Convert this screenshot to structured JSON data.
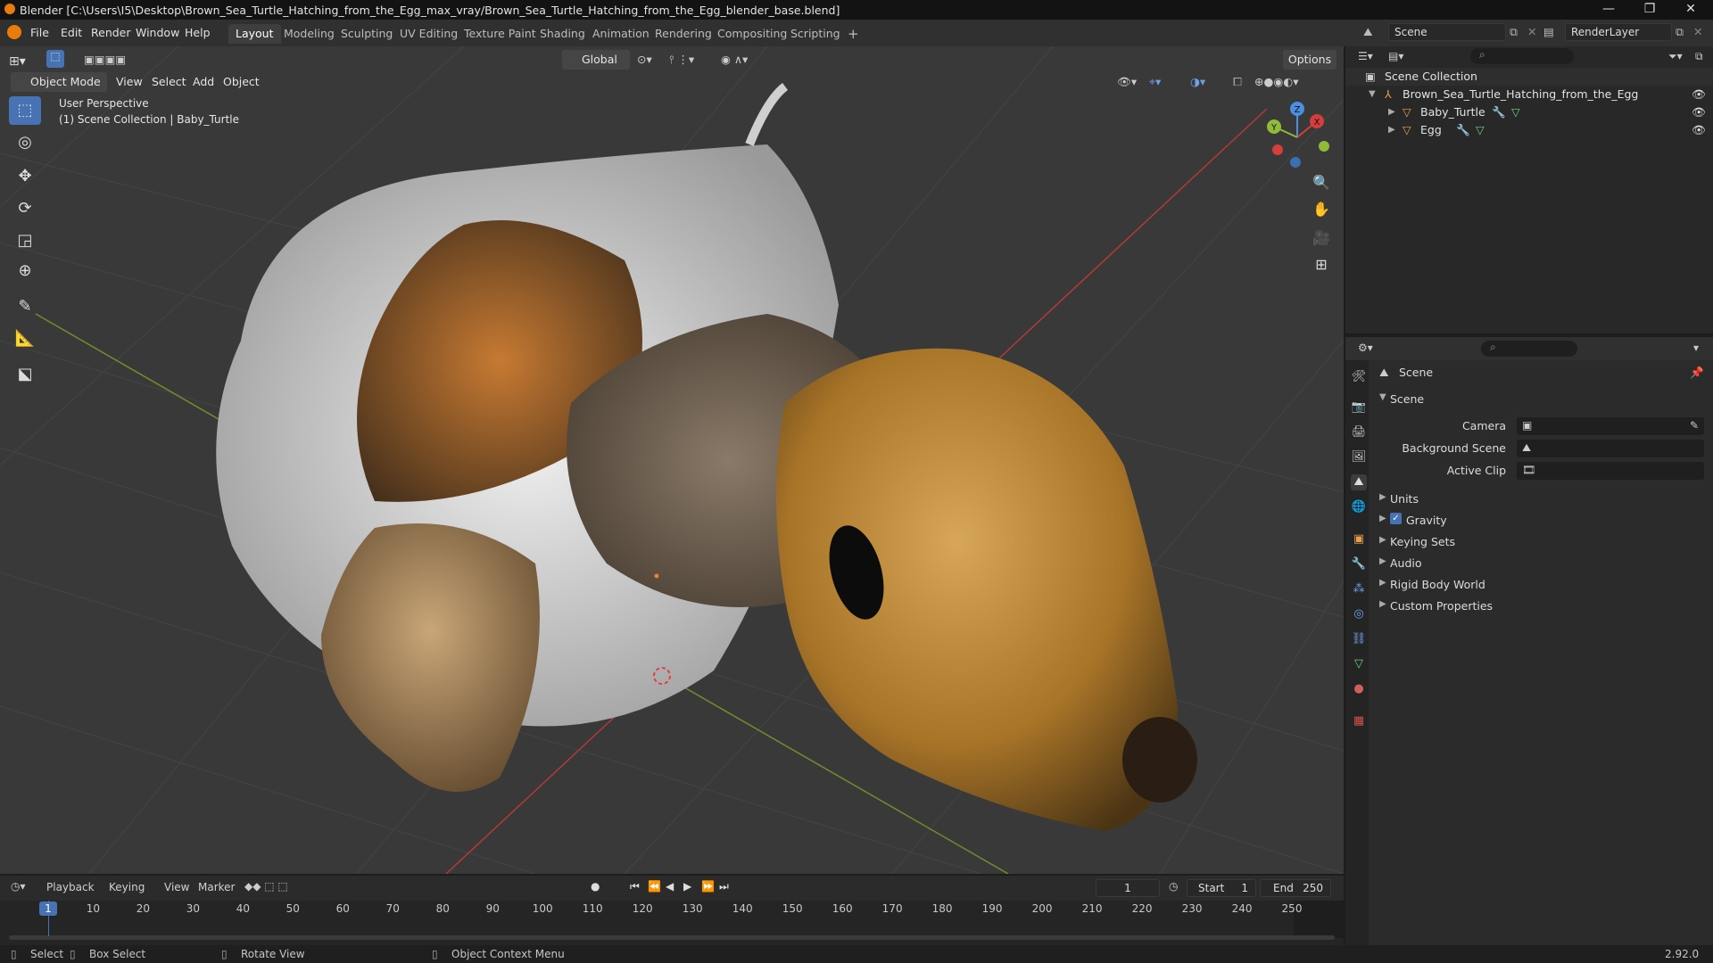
{
  "window": {
    "title": "Blender [C:\\Users\\I5\\Desktop\\Brown_Sea_Turtle_Hatching_from_the_Egg_max_vray/Brown_Sea_Turtle_Hatching_from_the_Egg_blender_base.blend]",
    "minimize": "—",
    "maximize": "❐",
    "close": "✕"
  },
  "menu": [
    "File",
    "Edit",
    "Render",
    "Window",
    "Help"
  ],
  "workspaces": [
    "Layout",
    "Modeling",
    "Sculpting",
    "UV Editing",
    "Texture Paint",
    "Shading",
    "Animation",
    "Rendering",
    "Compositing",
    "Scripting",
    "+"
  ],
  "scene_field": "Scene",
  "renderlayer_field": "RenderLayer",
  "viewport": {
    "mode": "Object Mode",
    "header_menus": [
      "View",
      "Select",
      "Add",
      "Object"
    ],
    "transform_orientation": "Global",
    "options": "Options",
    "perspective": "User Perspective",
    "collection_info": "(1) Scene Collection | Baby_Turtle",
    "gizmo_axes": [
      "X",
      "Y",
      "Z"
    ]
  },
  "outliner": {
    "root": "Scene Collection",
    "collection": "Brown_Sea_Turtle_Hatching_from_the_Egg",
    "objects": [
      "Baby_Turtle",
      "Egg"
    ]
  },
  "properties": {
    "header": "Scene",
    "panel": "Scene",
    "fields": [
      {
        "label": "Camera",
        "value": ""
      },
      {
        "label": "Background Scene",
        "value": ""
      },
      {
        "label": "Active Clip",
        "value": ""
      }
    ],
    "sections": [
      {
        "label": "Units",
        "checkbox": false
      },
      {
        "label": "Gravity",
        "checkbox": true
      },
      {
        "label": "Keying Sets",
        "checkbox": false
      },
      {
        "label": "Audio",
        "checkbox": false
      },
      {
        "label": "Rigid Body World",
        "checkbox": false
      },
      {
        "label": "Custom Properties",
        "checkbox": false
      }
    ]
  },
  "timeline": {
    "menus": [
      "Playback",
      "Keying",
      "View",
      "Marker"
    ],
    "current_frame": "1",
    "start_label": "Start",
    "start": "1",
    "end_label": "End",
    "end": "250",
    "ticks": [
      "1",
      "10",
      "20",
      "30",
      "40",
      "50",
      "60",
      "70",
      "80",
      "90",
      "100",
      "110",
      "120",
      "130",
      "140",
      "150",
      "160",
      "170",
      "180",
      "190",
      "200",
      "210",
      "220",
      "230",
      "240",
      "250"
    ]
  },
  "statusbar": {
    "items": [
      "Select",
      "Box Select",
      "Rotate View",
      "Object Context Menu"
    ],
    "version": "2.92.0"
  },
  "colors": {
    "accent": "#4772b3",
    "blender_orange": "#e87d0d",
    "x_axis": "#d63d3d",
    "y_axis": "#8fbb38",
    "z_axis": "#4a8fe0"
  }
}
